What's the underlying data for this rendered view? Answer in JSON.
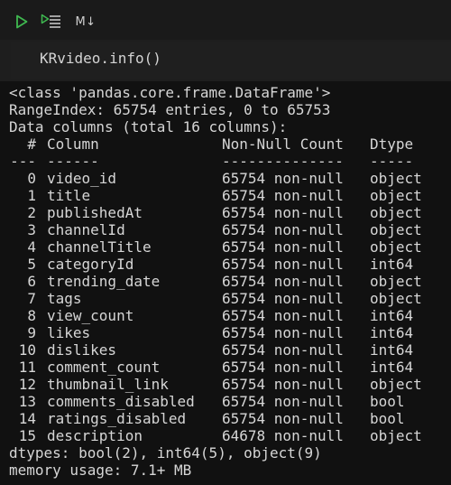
{
  "toolbar": {
    "run_icon": "play-triangle-icon",
    "run_below_icon": "run-below-icon",
    "markdown_label": "M↓"
  },
  "code": {
    "line": "KRvideo.info()"
  },
  "output": {
    "class_line": "<class 'pandas.core.frame.DataFrame'>",
    "range_line": "RangeIndex: 65754 entries, 0 to 65753",
    "data_columns_line": "Data columns (total 16 columns):",
    "header": {
      "idx": "#",
      "column": "Column",
      "count": "Non-Null Count",
      "dtype": "Dtype"
    },
    "separator": {
      "idx": "---",
      "column": "------",
      "count": "--------------",
      "dtype": "-----"
    },
    "rows": [
      {
        "idx": "0",
        "column": "video_id",
        "count": "65754 non-null",
        "dtype": "object"
      },
      {
        "idx": "1",
        "column": "title",
        "count": "65754 non-null",
        "dtype": "object"
      },
      {
        "idx": "2",
        "column": "publishedAt",
        "count": "65754 non-null",
        "dtype": "object"
      },
      {
        "idx": "3",
        "column": "channelId",
        "count": "65754 non-null",
        "dtype": "object"
      },
      {
        "idx": "4",
        "column": "channelTitle",
        "count": "65754 non-null",
        "dtype": "object"
      },
      {
        "idx": "5",
        "column": "categoryId",
        "count": "65754 non-null",
        "dtype": "int64"
      },
      {
        "idx": "6",
        "column": "trending_date",
        "count": "65754 non-null",
        "dtype": "object"
      },
      {
        "idx": "7",
        "column": "tags",
        "count": "65754 non-null",
        "dtype": "object"
      },
      {
        "idx": "8",
        "column": "view_count",
        "count": "65754 non-null",
        "dtype": "int64"
      },
      {
        "idx": "9",
        "column": "likes",
        "count": "65754 non-null",
        "dtype": "int64"
      },
      {
        "idx": "10",
        "column": "dislikes",
        "count": "65754 non-null",
        "dtype": "int64"
      },
      {
        "idx": "11",
        "column": "comment_count",
        "count": "65754 non-null",
        "dtype": "int64"
      },
      {
        "idx": "12",
        "column": "thumbnail_link",
        "count": "65754 non-null",
        "dtype": "object"
      },
      {
        "idx": "13",
        "column": "comments_disabled",
        "count": "65754 non-null",
        "dtype": "bool"
      },
      {
        "idx": "14",
        "column": "ratings_disabled",
        "count": "65754 non-null",
        "dtype": "bool"
      },
      {
        "idx": "15",
        "column": "description",
        "count": "64678 non-null",
        "dtype": "object"
      }
    ],
    "dtypes_line": "dtypes: bool(2), int64(5), object(9)",
    "memory_line": "memory usage: 7.1+ MB"
  },
  "colors": {
    "run_green": "#3fb950",
    "background": "#111111",
    "cell_background": "#1e1e1e",
    "text": "#d6d6d6"
  }
}
